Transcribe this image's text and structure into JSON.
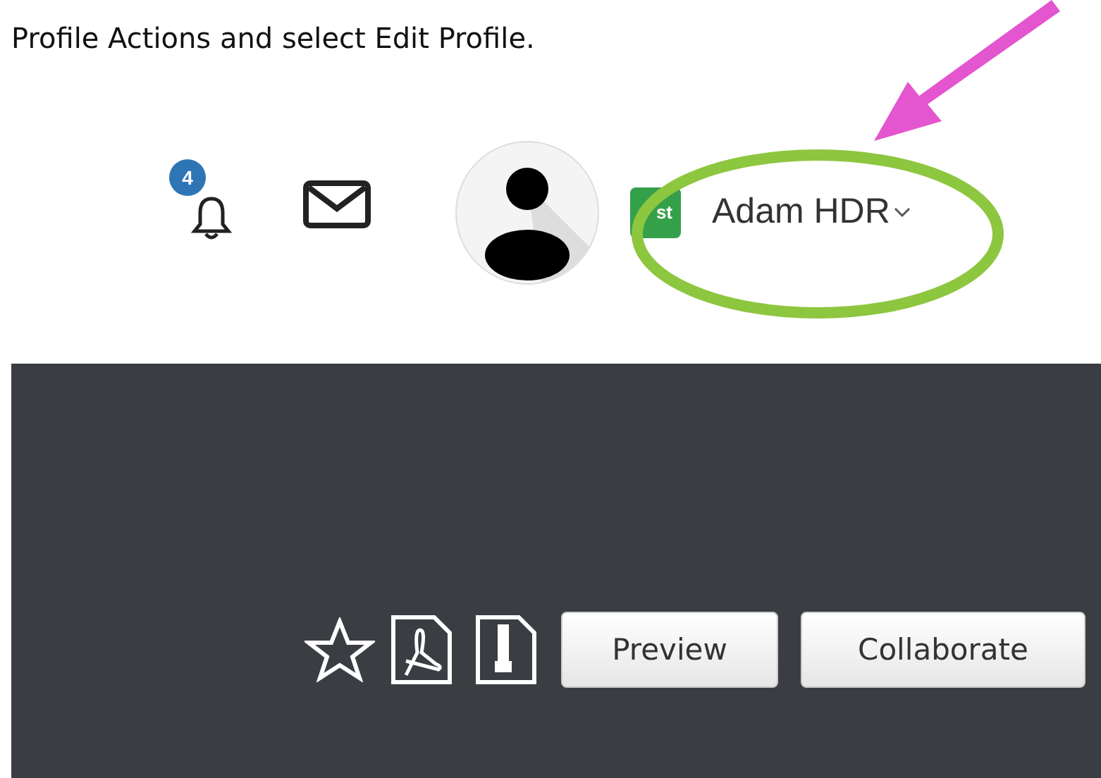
{
  "instruction": "Profile Actions and select Edit Profile.",
  "header": {
    "notification_count": "4",
    "badge": "st",
    "user_name": "Adam HDR"
  },
  "toolbar": {
    "buttons": [
      "Preview",
      "Collaborate"
    ]
  }
}
